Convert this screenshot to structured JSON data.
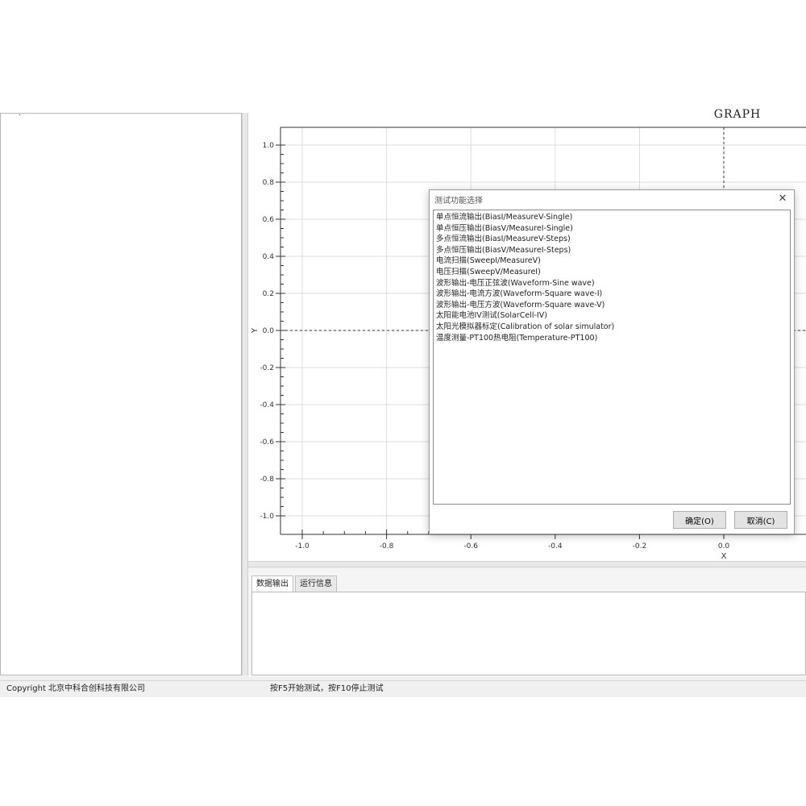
{
  "left_panel": {
    "mark": "·"
  },
  "graph": {
    "title": "GRAPH"
  },
  "chart_data": {
    "type": "line",
    "title": "GRAPH",
    "xlabel": "X",
    "ylabel": "Y",
    "xlim": [
      -1.1,
      0.0
    ],
    "ylim": [
      -1.1,
      1.0
    ],
    "x_ticks": [
      -1.0,
      -0.8,
      -0.6,
      -0.4,
      -0.2,
      0.0
    ],
    "x_tick_labels": [
      "-1.0",
      "-0.8",
      "-0.6",
      "-0.4",
      "-0.2",
      "0.0"
    ],
    "y_ticks": [
      1.0,
      0.8,
      0.6,
      0.4,
      0.2,
      0.0,
      -0.2,
      -0.4,
      -0.6,
      -0.8,
      -1.0
    ],
    "y_tick_labels": [
      "1.0",
      "0.8",
      "0.6",
      "0.4",
      "0.2",
      "0.0",
      "-0.2",
      "-0.4",
      "-0.6",
      "-0.8",
      "-1.0"
    ],
    "grid": true,
    "series": [],
    "crosshair": {
      "x": 0.0,
      "y": 0.0
    }
  },
  "dialog": {
    "title": "测试功能选择",
    "close_glyph": "✕",
    "items": [
      "单点恒流输出(BiasI/MeasureV-Single)",
      "单点恒压输出(BiasV/MeasureI-Single)",
      "多点恒流输出(BiasI/MeasureV-Steps)",
      "多点恒压输出(BiasV/MeasureI-Steps)",
      "电流扫描(SweepI/MeasureV)",
      "电压扫描(SweepV/MeasureI)",
      "波形输出-电压正弦波(Waveform-Sine wave)",
      "波形输出-电流方波(Waveform-Square wave-I)",
      "波形输出-电压方波(Waveform-Square wave-V)",
      "太阳能电池IV测试(SolarCell-IV)",
      "太阳光模拟器标定(Calibration of solar simulator)",
      "温度测量-PT100热电阻(Temperature-PT100)"
    ],
    "ok_label": "确定(O)",
    "cancel_label": "取消(C)"
  },
  "bottom_panel": {
    "tabs": [
      "数据输出",
      "运行信息"
    ]
  },
  "status_bar": {
    "left": "Copyright 北京中科合创科技有限公司",
    "right": "按F5开始测试，按F10停止测试"
  }
}
